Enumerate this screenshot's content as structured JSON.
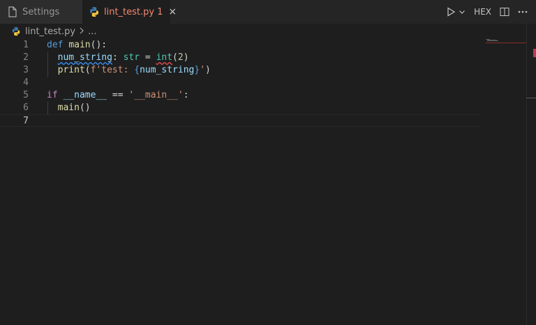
{
  "tabs": [
    {
      "label": "Settings",
      "icon": "file-icon"
    },
    {
      "label": "lint_test.py",
      "icon": "python-icon",
      "problem_count": "1",
      "close": "×"
    }
  ],
  "actions": {
    "hex_label": "HEX"
  },
  "breadcrumb": {
    "file": "lint_test.py",
    "more": "..."
  },
  "editor": {
    "line_numbers": [
      "1",
      "2",
      "3",
      "4",
      "5",
      "6",
      "7"
    ],
    "lines": [
      [
        {
          "t": "def",
          "c": "kw"
        },
        {
          "t": " ",
          "c": "op"
        },
        {
          "t": "main",
          "c": "fn"
        },
        {
          "t": "():",
          "c": "op"
        }
      ],
      [
        {
          "t": "  ",
          "c": "op"
        },
        {
          "t": "num_string",
          "c": "var squig-blue"
        },
        {
          "t": ": ",
          "c": "op"
        },
        {
          "t": "str",
          "c": "ty"
        },
        {
          "t": " = ",
          "c": "op"
        },
        {
          "t": "int",
          "c": "ty squig-red"
        },
        {
          "t": "(",
          "c": "op"
        },
        {
          "t": "2",
          "c": "num"
        },
        {
          "t": ")",
          "c": "op"
        }
      ],
      [
        {
          "t": "  ",
          "c": "op"
        },
        {
          "t": "print",
          "c": "fn"
        },
        {
          "t": "(",
          "c": "op"
        },
        {
          "t": "f'test: ",
          "c": "str"
        },
        {
          "t": "{",
          "c": "brace"
        },
        {
          "t": "num_string",
          "c": "var"
        },
        {
          "t": "}",
          "c": "brace"
        },
        {
          "t": "'",
          "c": "str"
        },
        {
          "t": ")",
          "c": "op"
        }
      ],
      [],
      [
        {
          "t": "if",
          "c": "kw2"
        },
        {
          "t": " ",
          "c": "op"
        },
        {
          "t": "__name__",
          "c": "var"
        },
        {
          "t": " == ",
          "c": "op"
        },
        {
          "t": "'__main__'",
          "c": "str"
        },
        {
          "t": ":",
          "c": "op"
        }
      ],
      [
        {
          "t": "  ",
          "c": "op"
        },
        {
          "t": "main",
          "c": "fn"
        },
        {
          "t": "()",
          "c": "op"
        }
      ],
      []
    ],
    "active_line": 7
  },
  "colors": {
    "error": "#f14c4c",
    "warning_squiggle": "#3794ff",
    "tab_error_text": "#f48771"
  }
}
